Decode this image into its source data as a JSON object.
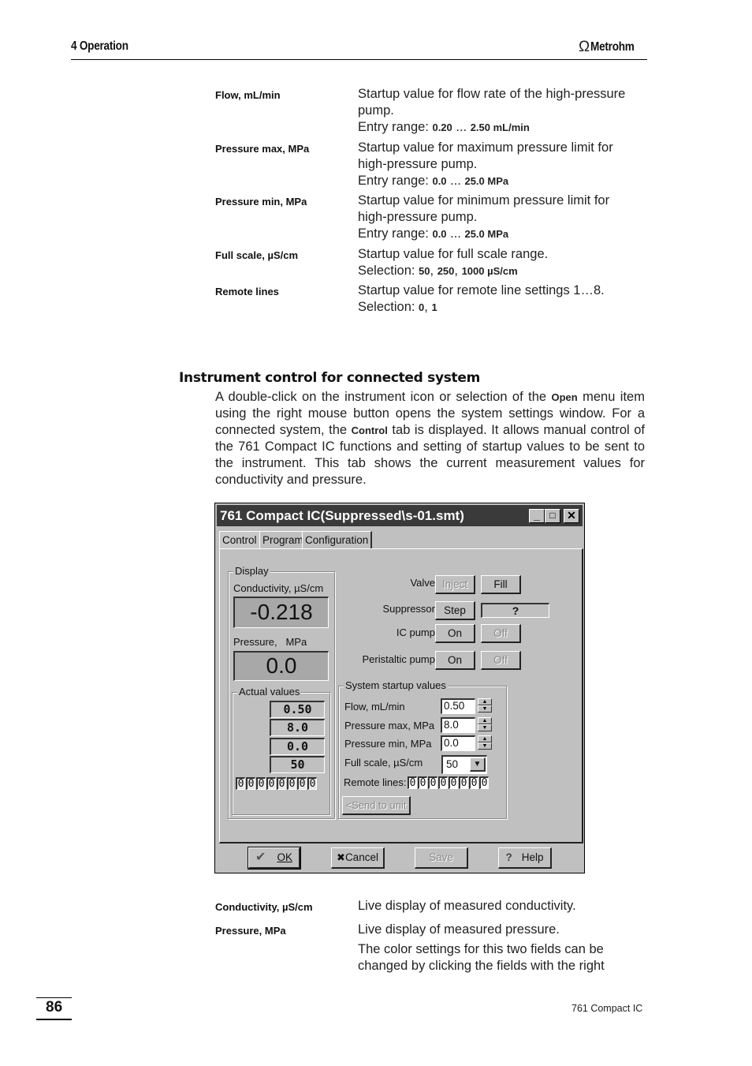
{
  "header": {
    "chapter": "4 Operation",
    "brand": "Metrohm",
    "logo_icon": "omega-logo-icon"
  },
  "definitions_top": [
    {
      "term": "Flow, mL/min",
      "lines": [
        "Startup value for flow rate of the high-pressure",
        "pump."
      ],
      "range_prefix": "Entry range: ",
      "range_a": "0.20",
      "range_sep": " ... ",
      "range_b": "2.50 mL/min"
    },
    {
      "term": "Pressure max, MPa",
      "lines": [
        "Startup value for maximum pressure limit for",
        "high-pressure pump."
      ],
      "range_prefix": "Entry range: ",
      "range_a": "0.0",
      "range_sep": " ... ",
      "range_b": "25.0 MPa"
    },
    {
      "term": "Pressure min, MPa",
      "lines": [
        "Startup value for minimum pressure limit for",
        "high-pressure pump."
      ],
      "range_prefix": "Entry range: ",
      "range_a": "0.0",
      "range_sep": " ... ",
      "range_b": "25.0 MPa"
    },
    {
      "term": "Full scale, µS/cm",
      "lines": [
        "Startup value for full scale range."
      ],
      "range_prefix": "Selection: ",
      "range_a": "50",
      "range_sep": ", ",
      "range_b": "250",
      "range_sep2": ", ",
      "range_c": "1000 µS/cm"
    },
    {
      "term": "Remote lines",
      "lines": [
        "Startup value for remote line settings 1…8."
      ],
      "range_prefix": "Selection: ",
      "range_a": "0",
      "range_sep": ", ",
      "range_b": "1"
    }
  ],
  "section": {
    "title": "Instrument control for connected system",
    "para_1": "A double-click on the instrument icon or selection of the ",
    "para_open": "Open",
    "para_2": " menu item using the right mouse button opens the system settings window. For a connected system, the ",
    "para_control": "Control",
    "para_3": " tab is displayed. It allows manual control of the 761 Compact IC functions and setting of startup values to be sent to the instrument. This tab shows the current measurement values for conductivity and pressure."
  },
  "dialog": {
    "title": "761 Compact IC(Suppressed\\s-01.smt)",
    "window_buttons": {
      "minimize": "_",
      "maximize": "□",
      "close": "✕"
    },
    "tabs": [
      "Control",
      "Program",
      "Configuration"
    ],
    "active_tab": "Control",
    "display": {
      "group_label": "Display",
      "conductivity_label": "Conductivity, µS/cm",
      "conductivity_value": "-0.218",
      "pressure_label": "Pressure,   MPa",
      "pressure_value": "0.0"
    },
    "actual_values": {
      "group_label": "Actual values",
      "values": [
        "0.50",
        "8.0",
        "0.0",
        "50"
      ],
      "remote_bits": [
        "0",
        "0",
        "0",
        "0",
        "0",
        "0",
        "0",
        "0"
      ]
    },
    "controls": {
      "valve_label": "Valve",
      "valve_inject": "Inject",
      "valve_fill": "Fill",
      "suppressor_label": "Suppressor",
      "suppressor_step": "Step",
      "suppressor_status": "?",
      "ic_pump_label": "IC pump",
      "ic_pump_on": "On",
      "ic_pump_off": "Off",
      "peristaltic_label": "Peristaltic pump",
      "peristaltic_on": "On",
      "peristaltic_off": "Off"
    },
    "startup": {
      "group_label": "System startup values",
      "flow_label": "Flow, mL/min",
      "flow_value": "0.50",
      "pmax_label": "Pressure max, MPa",
      "pmax_value": "8.0",
      "pmin_label": "Pressure min, MPa",
      "pmin_value": "0.0",
      "fullscale_label": "Full scale, µS/cm",
      "fullscale_value": "50",
      "remote_label": "Remote lines:",
      "remote_bits": [
        "0",
        "0",
        "0",
        "0",
        "0",
        "0",
        "0",
        "0"
      ],
      "send_button": "<Send to unit"
    },
    "footer_buttons": {
      "ok": "OK",
      "ok_icon": "✔",
      "cancel": "Cancel",
      "cancel_icon": "✖",
      "save": "Save",
      "help": "Help",
      "help_icon": "?"
    }
  },
  "definitions_bottom": [
    {
      "term": "Conductivity, µS/cm",
      "text": "Live display of measured conductivity."
    },
    {
      "term": "Pressure, MPa",
      "text": "Live display of measured pressure.",
      "extra_1": "The color settings for this two fields can be",
      "extra_2": "changed by clicking the fields with the right"
    }
  ],
  "footer": {
    "page_number": "86",
    "product": "761 Compact IC"
  }
}
